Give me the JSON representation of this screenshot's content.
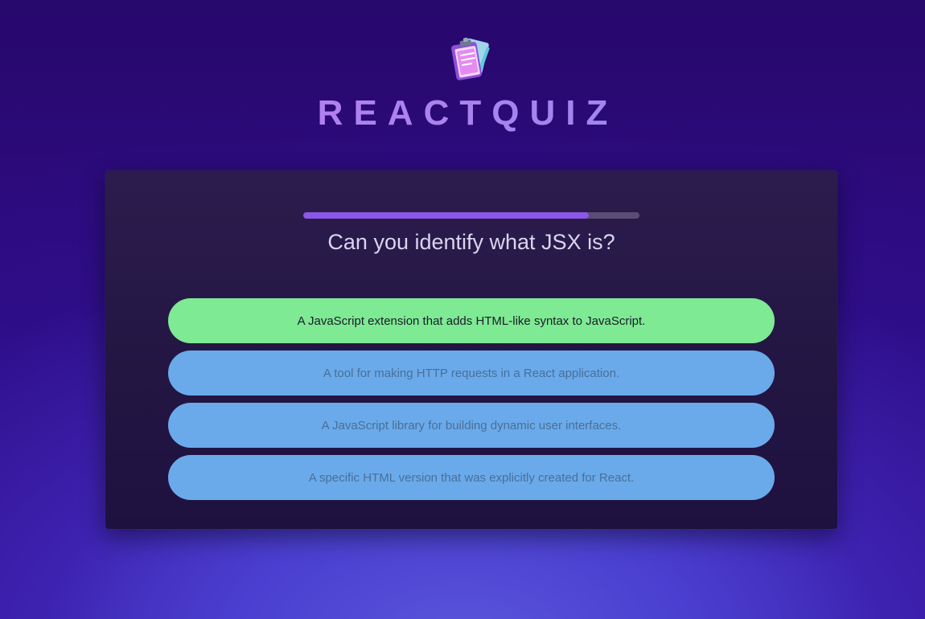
{
  "app": {
    "title": "REACTQUIZ",
    "logo_icon": "clipboard-quiz-icon"
  },
  "progress": {
    "value": 0.85
  },
  "question": {
    "text": "Can you identify what JSX is?"
  },
  "answers": [
    {
      "label": "A JavaScript extension that adds HTML-like syntax to JavaScript.",
      "state": "correct"
    },
    {
      "label": "A tool for making HTTP requests in a React application.",
      "state": "other"
    },
    {
      "label": "A JavaScript library for building dynamic user interfaces.",
      "state": "other"
    },
    {
      "label": "A specific HTML version that was explicitly created for React.",
      "state": "other"
    }
  ],
  "colors": {
    "background": "#2f0c86",
    "card": "#231643",
    "progress_fill": "#8a57e8",
    "correct": "#7eea93",
    "option": "#6aaaea"
  }
}
